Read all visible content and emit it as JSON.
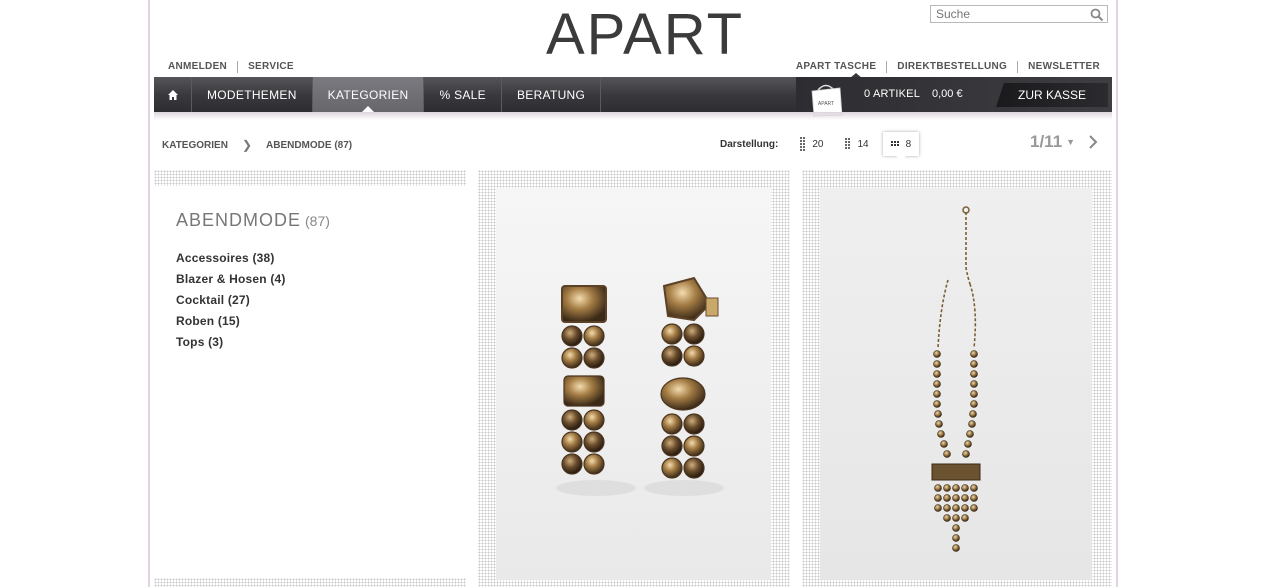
{
  "header": {
    "logo_text": "APART",
    "search_placeholder": "Suche",
    "left_links": [
      "ANMELDEN",
      "SERVICE"
    ],
    "right_links": [
      "APART TASCHE",
      "DIREKTBESTELLUNG",
      "NEWSLETTER"
    ]
  },
  "nav": {
    "home_icon": "home-icon",
    "items": [
      {
        "label": "MODETHEMEN",
        "active": false
      },
      {
        "label": "KATEGORIEN",
        "active": true
      },
      {
        "label": "% SALE",
        "active": false
      },
      {
        "label": "BERATUNG",
        "active": false
      }
    ],
    "cart": {
      "bag_label": "APART",
      "count_label": "0 ARTIKEL",
      "total_label": "0,00 €",
      "checkout_label": "ZUR KASSE"
    }
  },
  "breadcrumb": {
    "items": [
      "KATEGORIEN",
      "ABENDMODE (87)"
    ]
  },
  "display": {
    "label": "Darstellung:",
    "options": [
      {
        "value": "20",
        "active": false
      },
      {
        "value": "14",
        "active": false
      },
      {
        "value": "8",
        "active": true
      }
    ]
  },
  "pager": {
    "label": "1/11"
  },
  "sidebar": {
    "title": "ABENDMODE",
    "count": "(87)",
    "categories": [
      "Accessoires (38)",
      "Blazer & Hosen (4)",
      "Cocktail (27)",
      "Roben (15)",
      "Tops (3)"
    ]
  },
  "products": [
    {
      "image": "earrings-image"
    },
    {
      "image": "necklace-image"
    }
  ],
  "colors": {
    "nav_bg": "#3a3a3e",
    "nav_active": "#6e6e73",
    "gold": "#b08a46",
    "page_border": "#e3d3e0"
  }
}
